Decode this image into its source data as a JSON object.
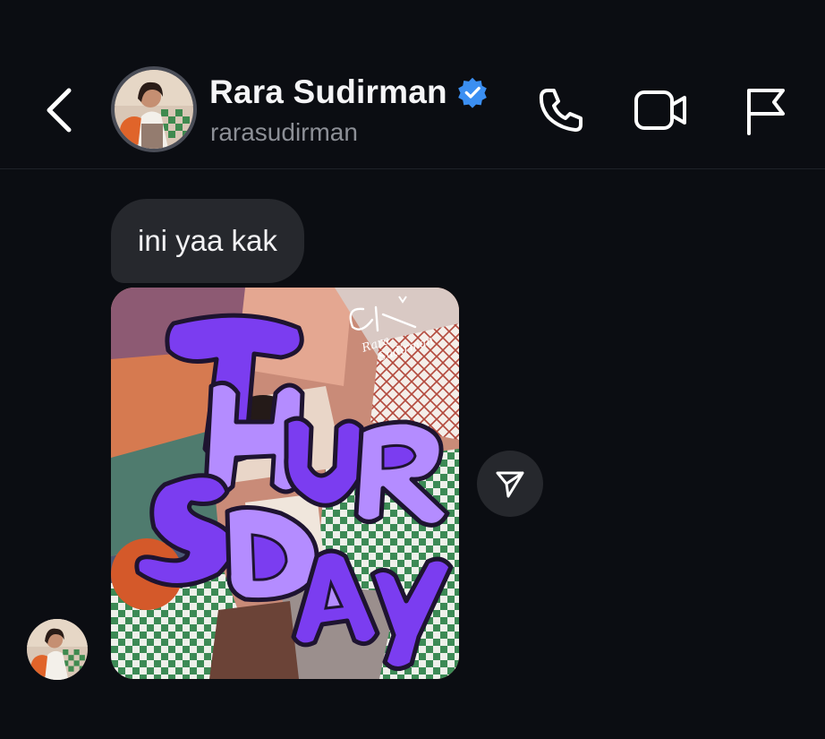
{
  "header": {
    "contact_name": "Rara Sudirman",
    "handle": "rarasudirman",
    "verified": true,
    "icons": {
      "back": "chevron-left-icon",
      "call": "phone-icon",
      "video": "video-camera-icon",
      "report": "flag-icon",
      "verified": "verified-badge-icon"
    }
  },
  "messages": [
    {
      "type": "text",
      "text": "ini yaa kak"
    },
    {
      "type": "image",
      "image_text": "THURSDAY",
      "watermark": [
        "Rara",
        "Sudirman"
      ]
    }
  ],
  "colors": {
    "background": "#0b0d12",
    "bubble": "#26282d",
    "verified": "#3b8ff2",
    "purple_dark": "#7b3df0",
    "purple_light": "#b48cff"
  }
}
